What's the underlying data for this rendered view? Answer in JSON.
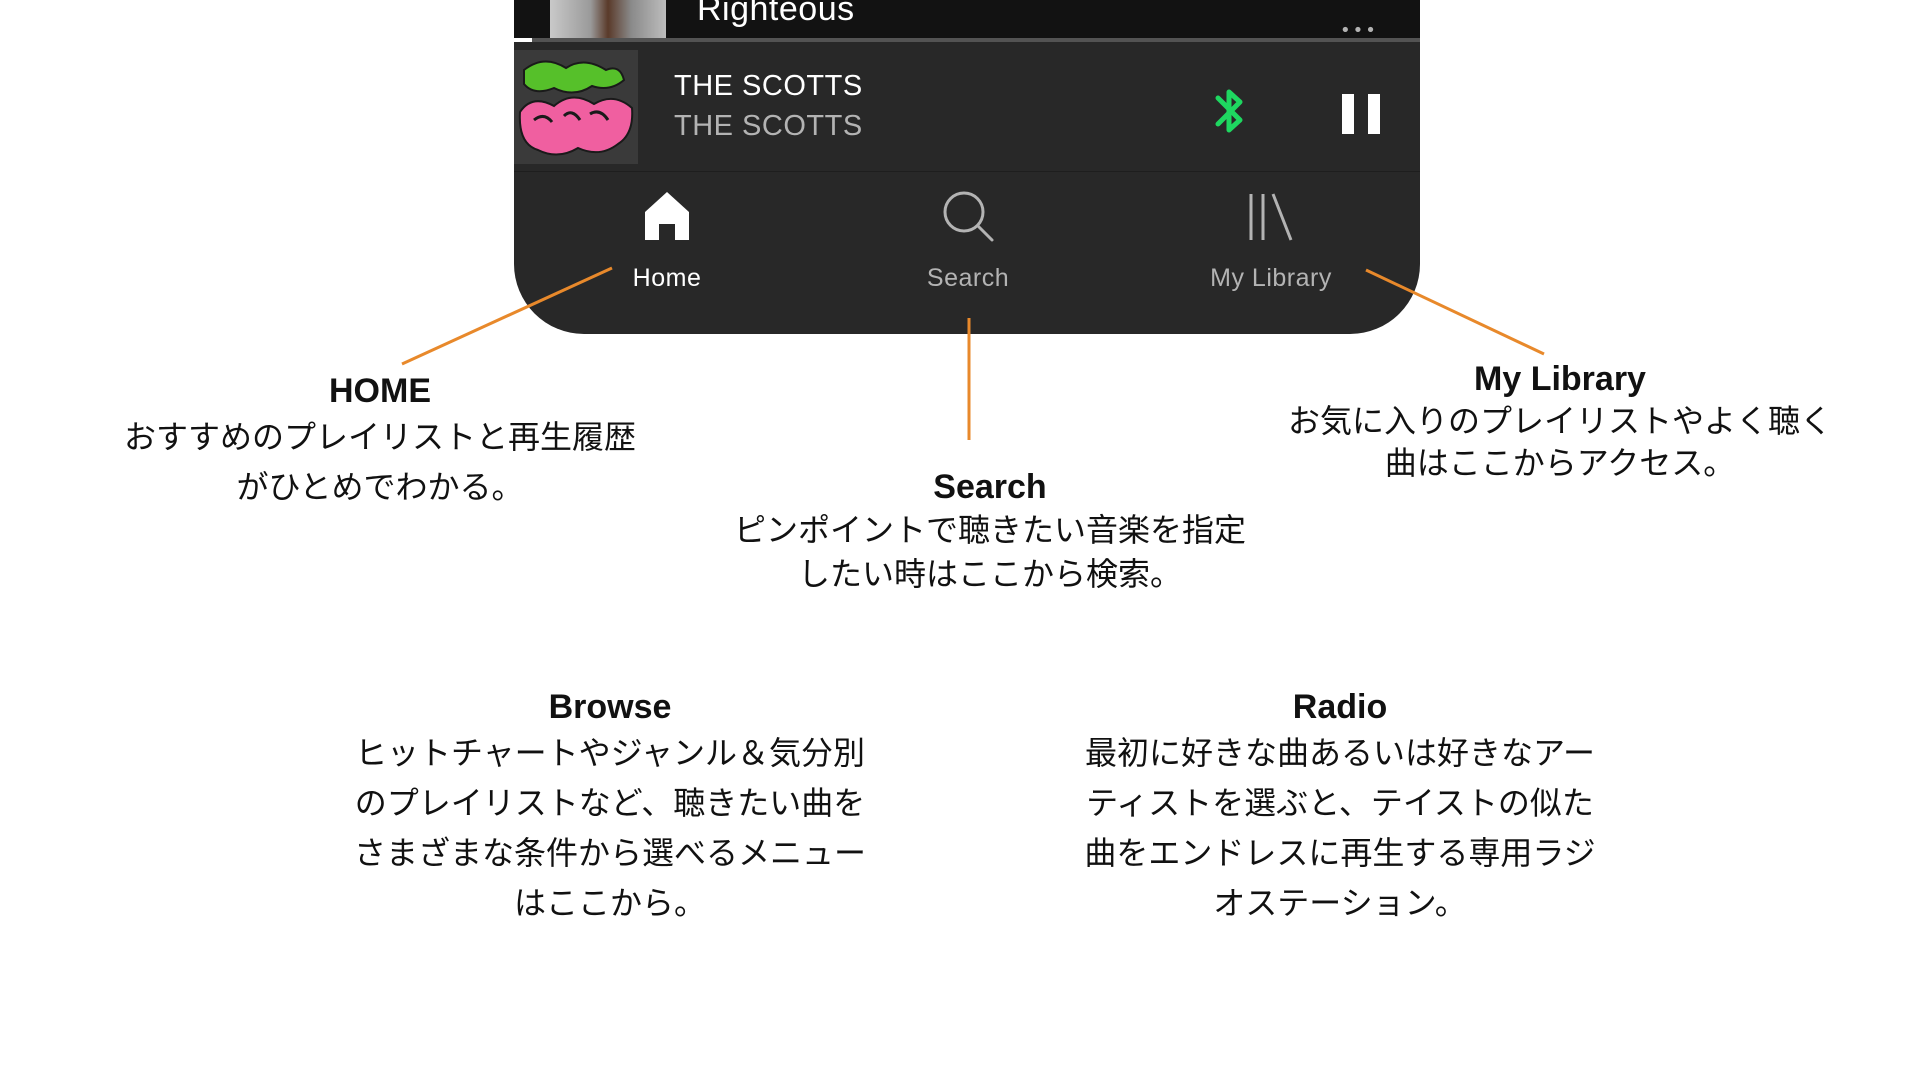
{
  "player": {
    "previous_track_title": "Righteous",
    "more_icon": "more-dots-icon",
    "progress_fraction": 0.02,
    "now_playing": {
      "title": "THE SCOTTS",
      "artist": "THE SCOTTS",
      "bluetooth_icon": "bluetooth-icon",
      "pause_icon": "pause-icon"
    },
    "colors": {
      "accent_green": "#1ed760",
      "bar_background": "#282828",
      "label_inactive": "#b3b3b3",
      "label_active": "#ffffff",
      "callout_orange": "#e8892b"
    }
  },
  "nav": {
    "items": [
      {
        "label": "Home",
        "icon": "home-icon",
        "active": true
      },
      {
        "label": "Search",
        "icon": "search-icon",
        "active": false
      },
      {
        "label": "My Library",
        "icon": "library-icon",
        "active": false
      }
    ]
  },
  "annotations": {
    "home": {
      "title": "HOME",
      "body": "おすすめのプレイリストと再生履歴\nがひとめでわかる。"
    },
    "search": {
      "title": "Search",
      "body": "ピンポイントで聴きたい音楽を指定\nしたい時はここから検索。"
    },
    "library": {
      "title": "My Library",
      "body": "お気に入りのプレイリストやよく聴く\n曲はここからアクセス。"
    },
    "browse": {
      "title": "Browse",
      "body": "ヒットチャートやジャンル＆気分別\nのプレイリストなど、聴きたい曲を\nさまざまな条件から選べるメニュー\nはここから。"
    },
    "radio": {
      "title": "Radio",
      "body": "最初に好きな曲あるいは好きなアー\nティストを選ぶと、テイストの似た\n曲をエンドレスに再生する専用ラジ\nオステーション。"
    }
  }
}
